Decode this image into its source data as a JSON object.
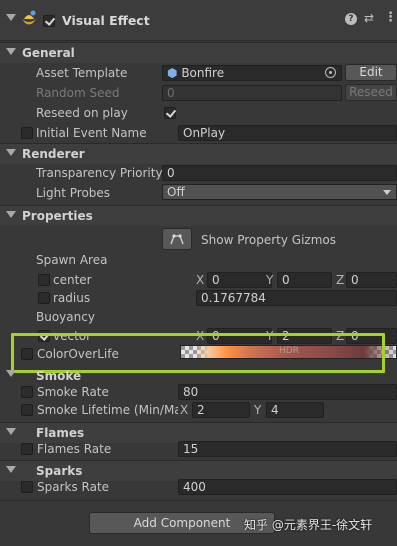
{
  "header": {
    "title": "Visual Effect",
    "enabled": true
  },
  "general": {
    "title": "General",
    "asset_template_label": "Asset Template",
    "asset_template_value": "Bonfire",
    "edit_label": "Edit",
    "random_seed_label": "Random Seed",
    "random_seed_value": "0",
    "reseed_button": "Reseed",
    "reseed_on_play_label": "Reseed on play",
    "reseed_on_play": true,
    "initial_event_label": "Initial Event Name",
    "initial_event_value": "OnPlay"
  },
  "renderer": {
    "title": "Renderer",
    "transparency_label": "Transparency Priority",
    "transparency_value": "0",
    "light_probes_label": "Light Probes",
    "light_probes_value": "Off"
  },
  "properties": {
    "title": "Properties",
    "gizmos_button": "Show Property Gizmos",
    "spawn_area_label": "Spawn Area",
    "center_label": "center",
    "center": {
      "x": "0",
      "y": "0",
      "z": "0"
    },
    "radius_label": "radius",
    "radius_value": "0.1767784",
    "buoyancy_label": "Buoyancy",
    "vector_label": "vector",
    "vector": {
      "x": "0",
      "y": "2",
      "z": "0"
    },
    "color_over_life_label": "ColorOverLife",
    "hdr_label": "HDR",
    "axis": {
      "x": "X",
      "y": "Y",
      "z": "Z"
    }
  },
  "smoke": {
    "title": "Smoke",
    "rate_label": "Smoke Rate",
    "rate_value": "80",
    "lifetime_label": "Smoke Lifetime (Min/Max",
    "lifetime_min": "2",
    "lifetime_max": "4"
  },
  "flames": {
    "title": "Flames",
    "rate_label": "Flames Rate",
    "rate_value": "15"
  },
  "sparks": {
    "title": "Sparks",
    "rate_label": "Sparks Rate",
    "rate_value": "400"
  },
  "add_component": "Add Component",
  "watermark": "知乎 @元素界王-徐文轩",
  "colors": {
    "highlight": "#a4d22a",
    "background": "#383838"
  }
}
